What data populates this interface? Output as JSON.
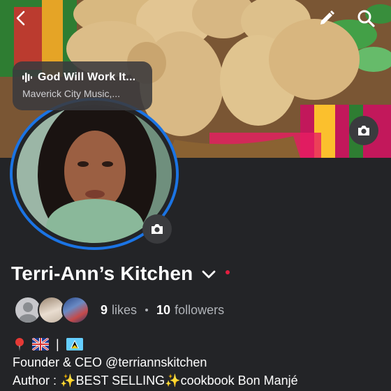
{
  "header": {
    "back_icon": "chevron-left-icon",
    "edit_icon": "pencil-icon",
    "search_icon": "search-icon"
  },
  "music": {
    "icon": "audio-bars-icon",
    "title": "God Will Work It...",
    "artist": "Maverick City Music,..."
  },
  "profile": {
    "name": "Terri-Ann’s Kitchen",
    "likes_count": "9",
    "likes_label": "likes",
    "followers_count": "10",
    "followers_label": "followers"
  },
  "bio": {
    "line1_emojis": [
      "📍",
      "🇬🇧",
      "|",
      "🇱🇨"
    ],
    "line1_separator": "|",
    "line2": "Founder & CEO @terriannskitchen",
    "line3": "Author : ✨BEST SELLING✨cookbook Bon Manjé"
  },
  "colors": {
    "background": "#232427",
    "accent": "#1b74e4",
    "notification_dot": "#e41e3f",
    "muted_text": "#b0b3b8"
  }
}
